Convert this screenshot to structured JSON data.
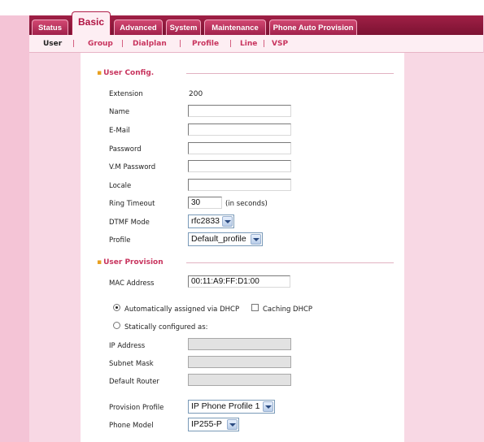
{
  "tabs": [
    "Status",
    "Basic",
    "Advanced",
    "System",
    "Maintenance",
    "Phone Auto Provision"
  ],
  "active_tab": "Basic",
  "subnav": [
    "User",
    "Group",
    "Dialplan",
    "Profile",
    "Line",
    "VSP"
  ],
  "subnav_separator": "|",
  "active_subnav": "User",
  "user_config": {
    "title": "User Config.",
    "extension_label": "Extension",
    "extension_value": "200",
    "name_label": "Name",
    "name_value": "",
    "email_label": "E-Mail",
    "email_value": "",
    "password_label": "Password",
    "password_value": "",
    "vm_password_label": "V.M Password",
    "vm_password_value": "",
    "locale_label": "Locale",
    "locale_value": "",
    "ring_timeout_label": "Ring Timeout",
    "ring_timeout_value": "30",
    "ring_timeout_unit": "(in seconds)",
    "dtmf_mode_label": "DTMF Mode",
    "dtmf_mode_value": "rfc2833",
    "profile_label": "Profile",
    "profile_value": "Default_profile"
  },
  "user_provision": {
    "title": "User Provision",
    "mac_label": "MAC Address",
    "mac_value": "00:11:A9:FF:D1:00",
    "auto_dhcp_label": "Automatically assigned via DHCP",
    "auto_dhcp_selected": true,
    "caching_dhcp_label": "Caching DHCP",
    "caching_dhcp_checked": false,
    "static_label": "Statically configured as:",
    "static_selected": false,
    "ip_label": "IP Address",
    "subnet_label": "Subnet Mask",
    "router_label": "Default Router",
    "provision_profile_label": "Provision Profile",
    "provision_profile_value": "IP Phone Profile 1",
    "phone_model_label": "Phone Model",
    "phone_model_value": "IP255-P"
  },
  "colors": {
    "accent": "#c8345e",
    "tabbar": "#8c1a3c",
    "page_bg": "#f4c4d6",
    "side_band": "#f8d8e4",
    "section_bullet": "#e8a020"
  }
}
